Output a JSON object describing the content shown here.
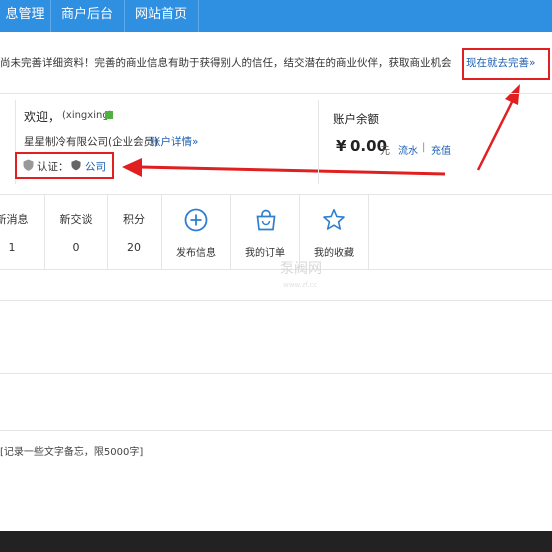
{
  "nav": {
    "tabs": [
      "息管理",
      "商户后台",
      "网站首页"
    ]
  },
  "notice": {
    "text": "尚未完善详细资料！完善的商业信息有助于获得别人的信任，结交潜在的商业伙伴，获取商业机会",
    "link": "现在就去完善»"
  },
  "profile": {
    "welcome": "欢迎，",
    "username": "(xingxing)",
    "company": "星星制冷有限公司(企业会员)",
    "account_detail": "账户详情»",
    "cert_label": "认证：",
    "cert_value": "公司"
  },
  "balance": {
    "title": "账户余额",
    "currency": "¥",
    "amount": "0.00",
    "unit": "元",
    "flow": "流水",
    "divider": "|",
    "recharge": "充值"
  },
  "stats": [
    {
      "label": "新消息",
      "value": "1"
    },
    {
      "label": "新交谈",
      "value": "0"
    },
    {
      "label": "积分",
      "value": "20"
    }
  ],
  "actions": [
    {
      "label": "发布信息",
      "icon": "plus-circle-icon"
    },
    {
      "label": "我的订单",
      "icon": "shopping-bag-icon"
    },
    {
      "label": "我的收藏",
      "icon": "star-icon"
    }
  ],
  "memo": {
    "placeholder": "[记录一些文字备忘，限5000字]"
  },
  "watermark": {
    "main": "泵阀网",
    "sub": "www.zf.cc"
  }
}
